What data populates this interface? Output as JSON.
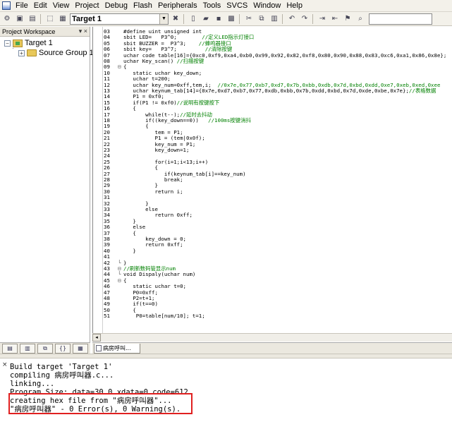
{
  "menu": [
    "File",
    "Edit",
    "View",
    "Project",
    "Debug",
    "Flash",
    "Peripherals",
    "Tools",
    "SVCS",
    "Window",
    "Help"
  ],
  "toolbar": {
    "target": "Target 1",
    "icons": [
      "open-icon",
      "save-icon",
      "target-options-icon",
      "translate-icon",
      "build-icon",
      "rebuild-icon",
      "new-file-icon",
      "open-file-icon",
      "save-file-icon",
      "save-all-icon",
      "cut-icon",
      "copy-icon",
      "paste-icon",
      "undo-icon",
      "redo-icon",
      "indent-icon",
      "outdent-icon",
      "bookmark-icon",
      "find-icon"
    ]
  },
  "workspace": {
    "title": "Project Workspace",
    "controls": "▾ ×",
    "tree": [
      {
        "label": "Target 1"
      },
      {
        "label": "Source Group 1"
      }
    ],
    "tabs": [
      "files-tab",
      "books-tab",
      "functions-tab",
      "templates-tab",
      "regs-tab"
    ]
  },
  "editor": {
    "file_tab": "病房呼叫...",
    "lines": [
      {
        "n": "03",
        "f": " ",
        "t": "#define uint unsigned int"
      },
      {
        "n": "04",
        "f": " ",
        "t": "sbit LED=   P3^0;",
        "c": "        //定义LED指示灯接口"
      },
      {
        "n": "05",
        "f": " ",
        "t": "sbit BUZZER =  P3^3;",
        "c": "    //蜂鸣器接口"
      },
      {
        "n": "06",
        "f": " ",
        "t": "sbit key=   P3^7;",
        "c": "         //清除按键"
      },
      {
        "n": "07",
        "f": " ",
        "t": "uchar code table[16]={0xc0,0xf9,0xa4,0xb0,0x99,0x92,0x82,0xf8,0x80,0x90,0x88,0x83,0xc6,0xa1,0x86,0x8e};"
      },
      {
        "n": "08",
        "f": " ",
        "t": "uchar Key_scan()",
        "c": " //扫描按键"
      },
      {
        "n": "09",
        "f": "⊟",
        "t": "{"
      },
      {
        "n": "10",
        "f": " ",
        "t": "   static uchar key_down;"
      },
      {
        "n": "11",
        "f": " ",
        "t": "   uchar t=200;"
      },
      {
        "n": "12",
        "f": " ",
        "t": "   uchar key_num=0xff,tem,i;",
        "c": "  //0x7e,0x77,0xb7,0xd7,0x7b,0xbb,0xdb,0x7d,0xbd,0xdd,0xe7,0xeb,0xed,0xee"
      },
      {
        "n": "13",
        "f": " ",
        "t": "   uchar keynum_tab[14]={0x7e,0xd7,0xb7,0x77,0xdb,0xbb,0x7b,0xdd,0xbd,0x7d,0xde,0xbe,0x7e};",
        "c": "//表格数据"
      },
      {
        "n": "14",
        "f": " ",
        "t": "   P1 = 0xf0;"
      },
      {
        "n": "15",
        "f": " ",
        "t": "   if(P1 != 0xf0)",
        "c": "//说明有按键按下"
      },
      {
        "n": "16",
        "f": " ",
        "t": "   {"
      },
      {
        "n": "17",
        "f": " ",
        "t": "       while(t--);",
        "c": "//延时去抖动"
      },
      {
        "n": "18",
        "f": " ",
        "t": "       if((key_down==0))",
        "c": "   //100ms按键消抖"
      },
      {
        "n": "19",
        "f": " ",
        "t": "       {"
      },
      {
        "n": "20",
        "f": " ",
        "t": "          tem = P1;"
      },
      {
        "n": "21",
        "f": " ",
        "t": "          P1 = (tem|0x0f);"
      },
      {
        "n": "22",
        "f": " ",
        "t": "          key_num = P1;"
      },
      {
        "n": "23",
        "f": " ",
        "t": "          key_down=1;"
      },
      {
        "n": "24",
        "f": " ",
        "t": ""
      },
      {
        "n": "25",
        "f": " ",
        "t": "          for(i=1;i<13;i++)"
      },
      {
        "n": "26",
        "f": " ",
        "t": "          {"
      },
      {
        "n": "27",
        "f": " ",
        "t": "             if(keynum_tab[i]==key_num)"
      },
      {
        "n": "28",
        "f": " ",
        "t": "             break;"
      },
      {
        "n": "29",
        "f": " ",
        "t": "          }"
      },
      {
        "n": "30",
        "f": " ",
        "t": "          return i;"
      },
      {
        "n": "31",
        "f": " ",
        "t": ""
      },
      {
        "n": "32",
        "f": " ",
        "t": "       }"
      },
      {
        "n": "33",
        "f": " ",
        "t": "       else"
      },
      {
        "n": "34",
        "f": " ",
        "t": "          return 0xff;"
      },
      {
        "n": "35",
        "f": " ",
        "t": "   }"
      },
      {
        "n": "36",
        "f": " ",
        "t": "   else"
      },
      {
        "n": "37",
        "f": " ",
        "t": "   {"
      },
      {
        "n": "38",
        "f": " ",
        "t": "       key_down = 0;"
      },
      {
        "n": "39",
        "f": " ",
        "t": "       return 0xff;"
      },
      {
        "n": "40",
        "f": " ",
        "t": "   }"
      },
      {
        "n": "41",
        "f": " ",
        "t": ""
      },
      {
        "n": "42",
        "f": "└",
        "t": "}"
      },
      {
        "n": "43",
        "f": "⊟",
        "t": "",
        "c": "//刷新数码管显示num"
      },
      {
        "n": "44",
        "f": "└",
        "t": "void Dispaly(uchar num)"
      },
      {
        "n": "45",
        "f": "⊟",
        "t": "{"
      },
      {
        "n": "46",
        "f": " ",
        "t": "   static uchar t=0;"
      },
      {
        "n": "47",
        "f": " ",
        "t": "   P0=0xff;"
      },
      {
        "n": "48",
        "f": " ",
        "t": "   P2=t+1;"
      },
      {
        "n": "49",
        "f": " ",
        "t": "   if(t==0)"
      },
      {
        "n": "50",
        "f": " ",
        "t": "   {"
      },
      {
        "n": "51",
        "f": " ",
        "t": "    P0=table[num/10]; t=1;"
      }
    ]
  },
  "output": {
    "lines": [
      "Build target 'Target 1'",
      "compiling 病房呼叫器.c...",
      "linking...",
      "Program Size: data=30.0 xdata=0 code=612",
      "creating hex file from \"病房呼叫器\"...",
      "\"病房呼叫器\" - 0 Error(s), 0 Warning(s)."
    ]
  },
  "colors": {
    "comment": "#008000",
    "highlight": "#e02020",
    "chrome": "#f3f1ea"
  }
}
